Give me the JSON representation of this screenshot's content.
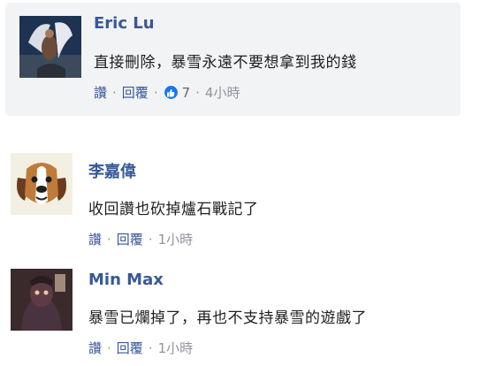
{
  "comments": [
    {
      "name": "Eric Lu",
      "text": "直接刪除，暴雪永遠不要想拿到我的錢",
      "like_label": "讚",
      "reply_label": "回覆",
      "reaction_count": "7",
      "time": "4小時"
    },
    {
      "name": "李嘉偉",
      "text": "收回讚也砍掉爐石戰記了",
      "like_label": "讚",
      "reply_label": "回覆",
      "time": "1小時"
    },
    {
      "name": "Min Max",
      "text": "暴雪已爛掉了，再也不支持暴雪的遊戲了",
      "like_label": "讚",
      "reply_label": "回覆",
      "time": "1小時"
    }
  ],
  "colors": {
    "name_link": "#385898",
    "bubble": "#f2f3f5",
    "meta": "#90949c",
    "like_badge": "#1877f2"
  },
  "icons": [
    "thumbs-up-icon"
  ]
}
